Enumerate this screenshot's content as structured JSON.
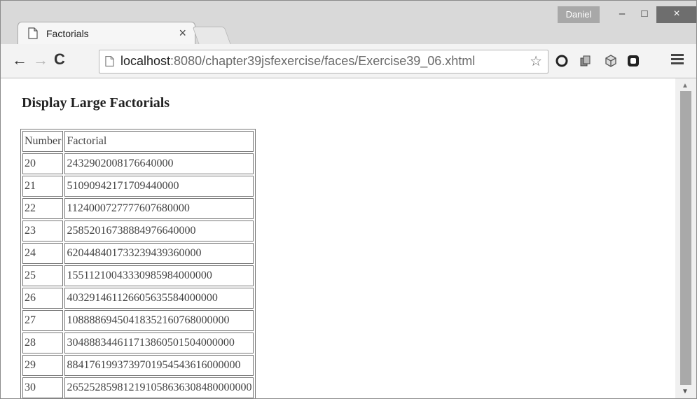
{
  "tab": {
    "title": "Factorials",
    "close_glyph": "×"
  },
  "user": {
    "name": "Daniel"
  },
  "window_controls": {
    "minimize": "–",
    "maximize": "□",
    "close": "×"
  },
  "nav": {
    "back": "←",
    "forward": "→",
    "reload": "C"
  },
  "address": {
    "host": "localhost",
    "path": ":8080/chapter39jsfexercise/faces/Exercise39_06.xhtml"
  },
  "page": {
    "heading": "Display Large Factorials",
    "table": {
      "headers": [
        "Number",
        "Factorial"
      ],
      "rows": [
        [
          "20",
          "2432902008176640000"
        ],
        [
          "21",
          "51090942171709440000"
        ],
        [
          "22",
          "1124000727777607680000"
        ],
        [
          "23",
          "25852016738884976640000"
        ],
        [
          "24",
          "620448401733239439360000"
        ],
        [
          "25",
          "15511210043330985984000000"
        ],
        [
          "26",
          "403291461126605635584000000"
        ],
        [
          "27",
          "10888869450418352160768000000"
        ],
        [
          "28",
          "304888344611713860501504000000"
        ],
        [
          "29",
          "8841761993739701954543616000000"
        ],
        [
          "30",
          "265252859812191058636308480000000"
        ]
      ]
    }
  },
  "scrollbar": {
    "up": "▲",
    "down": "▼"
  },
  "colors": {
    "chrome_bg": "#d9d9d9",
    "toolbar_bg": "#f3f3f3",
    "close_button": "#6e6e6e",
    "user_badge": "#a8a8a8"
  }
}
